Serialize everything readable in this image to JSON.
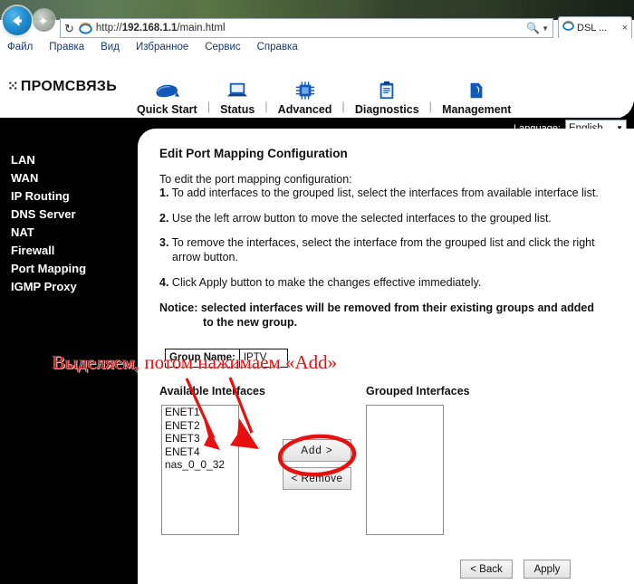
{
  "browser": {
    "back_icon": "back-arrow-icon",
    "forward_icon": "forward-arrow-icon",
    "refresh_icon": "refresh-icon",
    "url": "http://192.168.1.1/main.html",
    "url_host": "192.168.1.1",
    "url_scheme": "http://",
    "url_path": "/main.html",
    "search_icon": "search-icon",
    "dropdown_icon": "chevron-down-icon",
    "tab_label": "DSL ...",
    "tab_close": "×",
    "menu": [
      "Файл",
      "Правка",
      "Вид",
      "Избранное",
      "Сервис",
      "Справка"
    ]
  },
  "router": {
    "brand": "ПРОМСВЯЗЬ",
    "nav": [
      {
        "label": "Quick Start",
        "icon": "mouse-icon"
      },
      {
        "label": "Status",
        "icon": "laptop-icon"
      },
      {
        "label": "Advanced",
        "icon": "chip-icon"
      },
      {
        "label": "Diagnostics",
        "icon": "clipboard-icon"
      },
      {
        "label": "Management",
        "icon": "folder-icon"
      }
    ],
    "language": {
      "label": "Language:",
      "value": "English",
      "icon": "chevron-down-icon"
    },
    "sidebar": {
      "items": [
        {
          "label": "LAN",
          "active": false
        },
        {
          "label": "WAN",
          "active": false
        },
        {
          "label": "IP Routing",
          "active": false
        },
        {
          "label": "DNS Server",
          "active": false
        },
        {
          "label": "NAT",
          "active": false
        },
        {
          "label": "Firewall",
          "active": false
        },
        {
          "label": "Port Mapping",
          "active": true
        },
        {
          "label": "IGMP Proxy",
          "active": false
        }
      ]
    },
    "page": {
      "title": "Edit Port Mapping Configuration",
      "lead": "To edit the port mapping configuration:",
      "steps": [
        {
          "num": "1.",
          "text": " To add interfaces to the grouped list, select the interfaces from available interface list.",
          "cont": ""
        },
        {
          "num": "2.",
          "text": " Use the left arrow button to move the selected interfaces to the grouped list.",
          "cont": ""
        },
        {
          "num": "3.",
          "text": " To remove the interfaces, select the interface from the grouped list and click the right",
          "cont": "arrow button."
        },
        {
          "num": "4.",
          "text": " Click Apply button to make the changes effective immediately.",
          "cont": ""
        }
      ],
      "notice_label": "Notice:",
      "notice_text": "  selected interfaces will be removed from their existing groups and added",
      "notice_cont": "to the new group.",
      "group_name_label": "Group Name:",
      "group_name_value": "IPTV",
      "available_label": "Available Interfaces",
      "grouped_label": "Grouped Interfaces",
      "available_interfaces": [
        "ENET1",
        "ENET2",
        "ENET3",
        "ENET4",
        "nas_0_0_32"
      ],
      "grouped_interfaces": [],
      "add_button": "Add   >",
      "remove_button": "<  Remove",
      "back_button": "<  Back",
      "apply_button": "Apply"
    }
  },
  "annotation": {
    "text": "Выделяем, потом нажимаем «Add»",
    "color": "#e8100f",
    "marks": [
      "arrow-1",
      "arrow-2",
      "ellipse-around-add-button"
    ]
  },
  "colors": {
    "accent_blue": "#1f8fd0",
    "menu_link": "#15396b",
    "annotation_red": "#e8100f",
    "sidebar_bg": "#000000",
    "panel_bg": "#ffffff"
  }
}
